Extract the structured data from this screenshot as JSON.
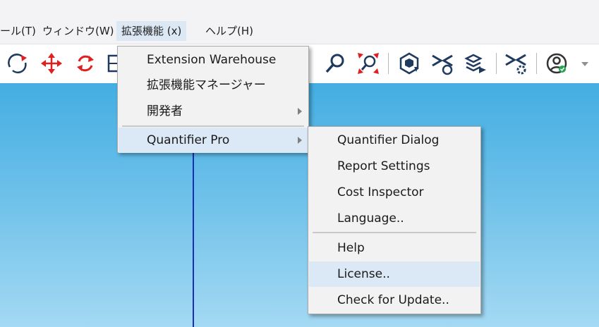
{
  "menubar": {
    "items": [
      {
        "label": "ール(T)"
      },
      {
        "label": "ウィンドウ(W)"
      },
      {
        "label": "拡張機能 (x)"
      },
      {
        "label": "ヘルプ(H)"
      }
    ]
  },
  "toolbar": {
    "icons": [
      "orbit-icon",
      "move-icon",
      "rotate-icon",
      "section-plane-icon",
      "zoom-icon",
      "zoom-extents-icon",
      "3d-warehouse-icon",
      "extension-warehouse-icon",
      "send-to-layout-icon",
      "extension-manager-icon",
      "account-icon",
      "dropdown-arrow-icon"
    ]
  },
  "extensions_menu": {
    "items": [
      {
        "label": "Extension Warehouse"
      },
      {
        "label": "拡張機能マネージャー"
      },
      {
        "label": "開発者"
      },
      {
        "label": "Quantifier Pro"
      }
    ]
  },
  "quantifier_submenu": {
    "items": [
      {
        "label": "Quantifier Dialog"
      },
      {
        "label": "Report Settings"
      },
      {
        "label": "Cost Inspector"
      },
      {
        "label": "Language.."
      },
      {
        "label": "Help"
      },
      {
        "label": "License.."
      },
      {
        "label": "Check for Update.."
      }
    ]
  },
  "colors": {
    "sky_top": "#44aee2",
    "sky_bottom": "#a4d9f3",
    "axis_blue": "#1a2fb8",
    "highlight": "#dbe8f6",
    "icon_red": "#e02020",
    "icon_navy": "#1f3a5f"
  }
}
